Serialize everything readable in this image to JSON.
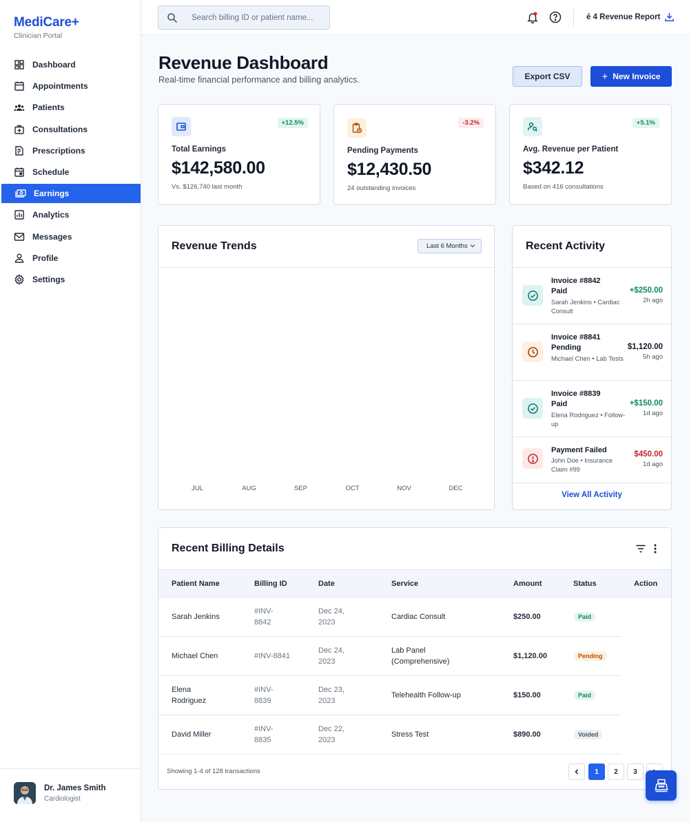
{
  "brand": {
    "name": "MediCare+",
    "subtitle": "Clinician Portal"
  },
  "sidebar": {
    "items": [
      {
        "label": "Dashboard",
        "icon": "dashboard-icon"
      },
      {
        "label": "Appointments",
        "icon": "calendar-icon"
      },
      {
        "label": "Patients",
        "icon": "patients-icon"
      },
      {
        "label": "Consultations",
        "icon": "medical-kit-icon"
      },
      {
        "label": "Prescriptions",
        "icon": "prescription-icon"
      },
      {
        "label": "Schedule",
        "icon": "schedule-icon"
      },
      {
        "label": "Earnings",
        "icon": "payments-icon",
        "active": true
      },
      {
        "label": "Analytics",
        "icon": "analytics-icon"
      },
      {
        "label": "Messages",
        "icon": "mail-icon"
      },
      {
        "label": "Profile",
        "icon": "person-icon"
      },
      {
        "label": "Settings",
        "icon": "gear-icon"
      }
    ]
  },
  "user": {
    "name": "Dr. James Smith",
    "role": "Cardiologist"
  },
  "topbar": {
    "search_placeholder": "Search billing ID or patient name...",
    "report_label": "é 4 Revenue Report"
  },
  "header": {
    "title": "Revenue Dashboard",
    "subtitle": "Real-time financial performance and billing analytics.",
    "export_label": "Export CSV",
    "new_invoice_label": "New Invoice"
  },
  "kpis": [
    {
      "label": "Total Earnings",
      "value": "$142,580.00",
      "change": "+12.5%",
      "note": "Vs. $126,740 last month",
      "trend": "up"
    },
    {
      "label": "Pending Payments",
      "value": "$12,430.50",
      "change": "-3.2%",
      "note": "24 outstanding invoices",
      "trend": "down"
    },
    {
      "label": "Avg. Revenue per Patient",
      "value": "$342.12",
      "change": "+5.1%",
      "note": "Based on 416 consultations",
      "trend": "up"
    }
  ],
  "revenue_trends": {
    "title": "Revenue Trends",
    "range_label": "Last 6 Months"
  },
  "chart_data": {
    "type": "bar",
    "title": "Revenue Trends",
    "categories": [
      "JUL",
      "AUG",
      "SEP",
      "OCT",
      "NOV",
      "DEC"
    ],
    "values": [],
    "xlabel": "",
    "ylabel": ""
  },
  "activity": {
    "title": "Recent Activity",
    "items": [
      {
        "title": "Invoice #8842 Paid",
        "meta": "Sarah Jenkins • Cardiac Consult",
        "amount": "+$250.00",
        "time": "2h ago",
        "status": "paid"
      },
      {
        "title": "Invoice #8841 Pending",
        "meta": "Michael Chen • Lab Tests",
        "amount": "$1,120.00",
        "time": "5h ago",
        "status": "pending"
      },
      {
        "title": "Invoice #8839 Paid",
        "meta": "Elena Rodriguez • Follow-up",
        "amount": "+$150.00",
        "time": "1d ago",
        "status": "paid"
      },
      {
        "title": "Payment Failed",
        "meta": "John Doe • Insurance Claim #99",
        "amount": "$450.00",
        "time": "1d ago",
        "status": "failed"
      }
    ],
    "view_all_label": "View All Activity"
  },
  "billing": {
    "title": "Recent Billing Details",
    "columns": [
      "Patient Name",
      "Billing ID",
      "Date",
      "Service",
      "Amount",
      "Status",
      "Action"
    ],
    "rows": [
      {
        "patient": "Sarah Jenkins",
        "id": "#INV-8842",
        "date": "Dec 24, 2023",
        "service": "Cardiac Consult",
        "amount": "$250.00",
        "status": "Paid"
      },
      {
        "patient": "Michael Chen",
        "id": "#INV-8841",
        "date": "Dec 24, 2023",
        "service": "Lab Panel (Comprehensive)",
        "amount": "$1,120.00",
        "status": "Pending"
      },
      {
        "patient": "Elena Rodriguez",
        "id": "#INV-8839",
        "date": "Dec 23, 2023",
        "service": "Telehealth Follow-up",
        "amount": "$150.00",
        "status": "Paid"
      },
      {
        "patient": "David Miller",
        "id": "#INV-8835",
        "date": "Dec 22, 2023",
        "service": "Stress Test",
        "amount": "$890.00",
        "status": "Voided"
      }
    ],
    "footer_text": "Showing 1-4 of 128 transactions",
    "pages": [
      "1",
      "2",
      "3"
    ]
  },
  "colors": {
    "primary": "#1d4ed8",
    "accent": "#2563eb",
    "success": "#0f8a5f",
    "danger": "#c0262d",
    "warning": "#b45309"
  }
}
